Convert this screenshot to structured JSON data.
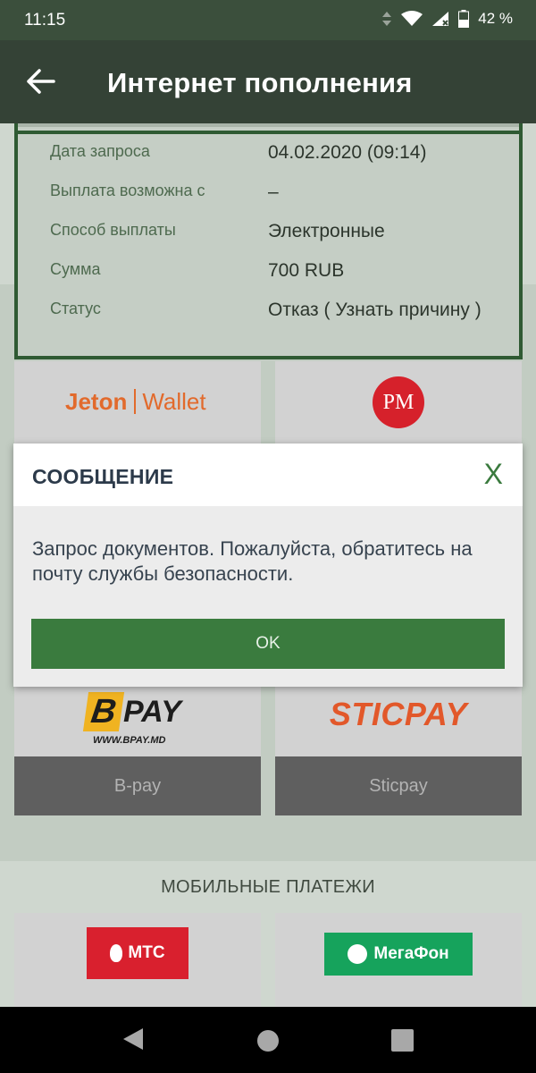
{
  "status_bar": {
    "time": "11:15",
    "battery": "42 %",
    "icons": [
      "data-arrows-icon",
      "wifi-icon",
      "signal-icon",
      "battery-icon"
    ]
  },
  "app_bar": {
    "title": "Интернет пополнения",
    "back_icon": "arrow-left-icon"
  },
  "request_info": {
    "rows": [
      {
        "label": "Дата запроса",
        "value": "04.02.2020 (09:14)"
      },
      {
        "label": "Выплата возможна с",
        "value": "–"
      },
      {
        "label": "Способ выплаты",
        "value": "Электронные"
      },
      {
        "label": "Сумма",
        "value": "700 RUB"
      },
      {
        "label": "Статус",
        "value": "Отказ ( Узнать причину )"
      }
    ]
  },
  "payment_tiles": [
    {
      "logo_text": "Jeton",
      "logo_text_2": "Wallet"
    },
    {
      "logo_text": "PM"
    },
    {
      "logo_text": "B",
      "logo_text_2": "PAY",
      "logo_sub": "WWW.BPAY.MD",
      "label": "B-pay"
    },
    {
      "logo_text": "STICPAY",
      "label": "Sticpay"
    }
  ],
  "mobile_section": {
    "title": "МОБИЛЬНЫЕ ПЛАТЕЖИ",
    "tiles": [
      {
        "logo_text": "МТС"
      },
      {
        "logo_text": "МегаФон"
      }
    ]
  },
  "dialog": {
    "title": "СООБЩЕНИЕ",
    "close_label": "X",
    "message": "Запрос документов. Пожалуйста, обратитесь на почту службы безопасности.",
    "ok_label": "OK"
  },
  "colors": {
    "app_bar": "#344236",
    "accent_green": "#3a7b3e",
    "jeton_orange": "#e26a2c",
    "pm_red": "#d6212b",
    "sticpay_orange": "#e2582a",
    "mts_red": "#d9202e",
    "megafon_green": "#16a35c"
  }
}
